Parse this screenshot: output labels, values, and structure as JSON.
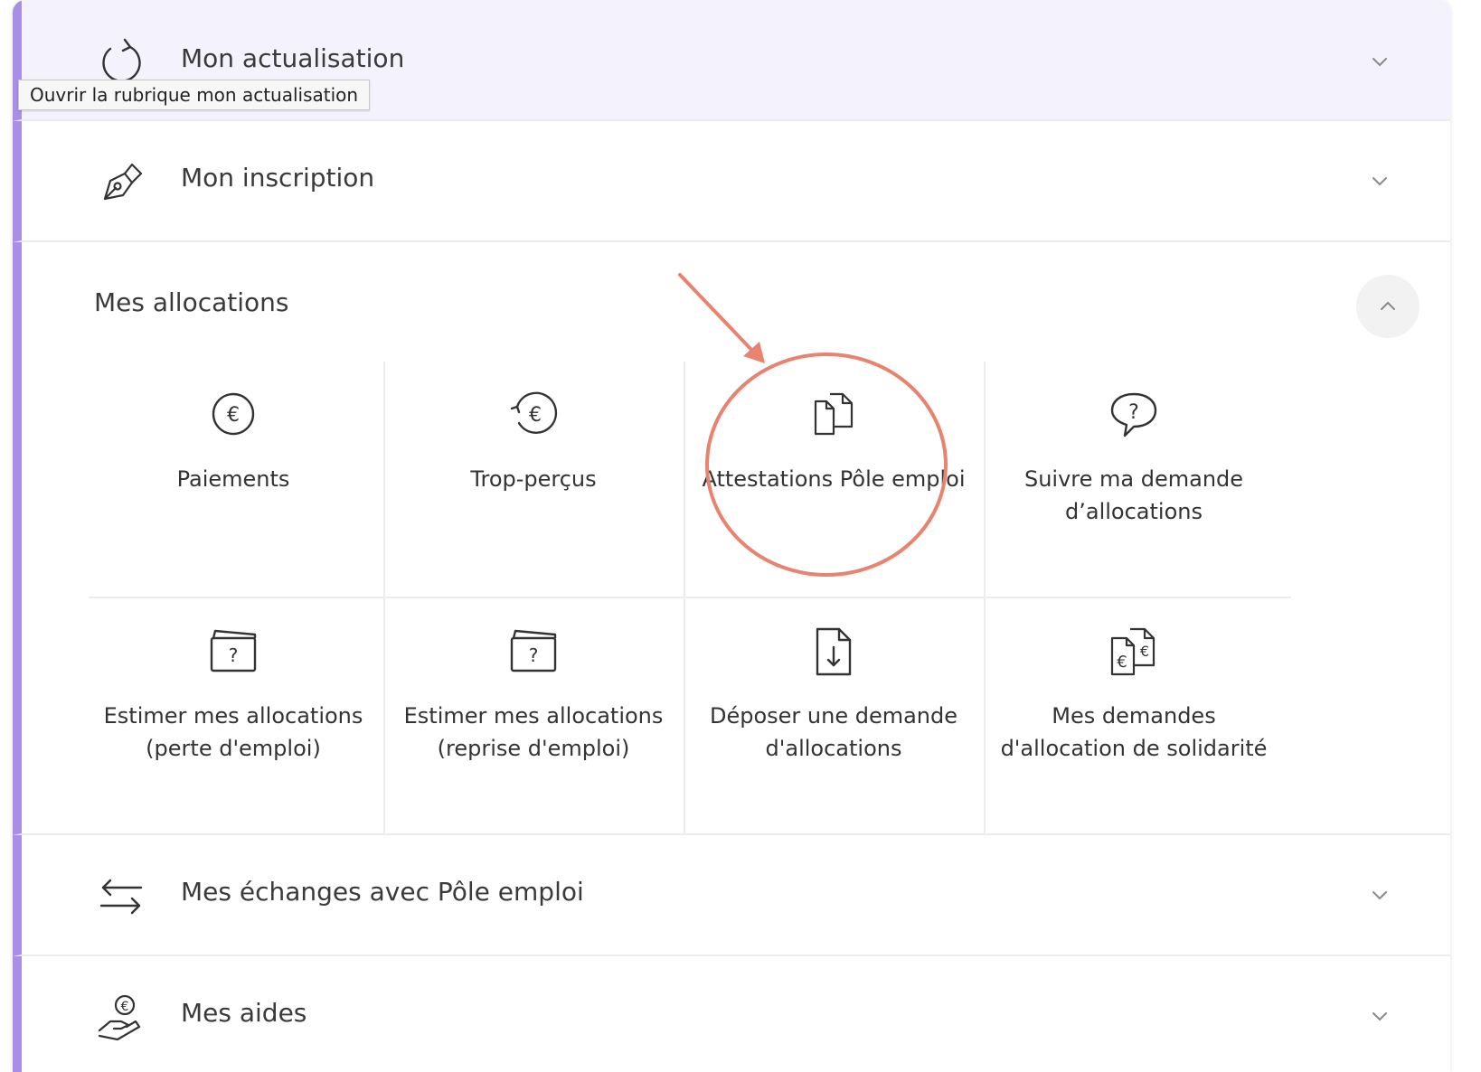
{
  "rows": {
    "actualisation": {
      "title": "Mon actualisation",
      "tooltip": "Ouvrir la rubrique mon actualisation",
      "icon": "refresh-icon"
    },
    "inscription": {
      "title": "Mon inscription",
      "icon": "pen-signature-icon"
    },
    "echanges": {
      "title": "Mes échanges avec Pôle emploi",
      "icon": "exchange-arrows-icon"
    },
    "aides": {
      "title": "Mes aides",
      "icon": "hand-euro-icon"
    }
  },
  "allocations": {
    "title": "Mes allocations",
    "tiles": [
      {
        "label": "Paiements",
        "icon": "euro-circle-icon"
      },
      {
        "label": "Trop-perçus",
        "icon": "euro-refund-icon"
      },
      {
        "label": "Attestations Pôle emploi",
        "icon": "documents-icon"
      },
      {
        "label": "Suivre ma demande d’allocations",
        "icon": "question-bubble-icon"
      },
      {
        "label": "Estimer mes allocations (perte d'emploi)",
        "icon": "wallet-question-icon"
      },
      {
        "label": "Estimer mes allocations (reprise d'emploi)",
        "icon": "wallet-question-icon"
      },
      {
        "label": "Déposer une demande d'allocations",
        "icon": "document-download-icon"
      },
      {
        "label": "Mes demandes d'allocation de solidarité",
        "icon": "euro-documents-icon"
      }
    ]
  },
  "colors": {
    "accent_bar": "#a98ee6",
    "hover_bg": "#f4f3fd",
    "annotation": "#e8836f"
  }
}
